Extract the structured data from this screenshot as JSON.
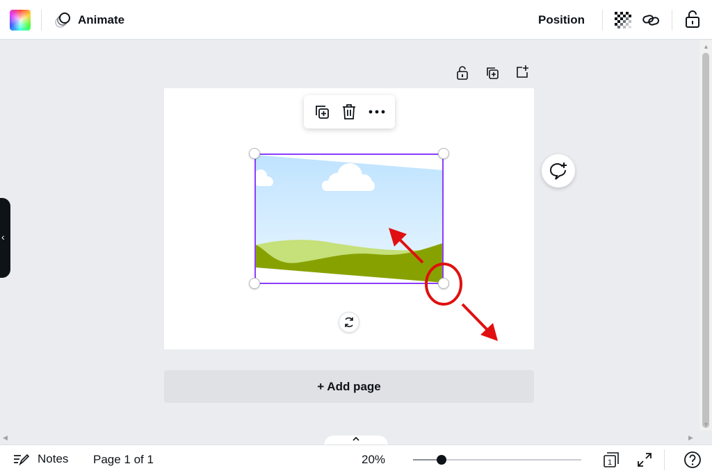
{
  "toolbar": {
    "animate_label": "Animate",
    "position_label": "Position",
    "icons": [
      "color-swatch",
      "animate-icon",
      "transparency-icon",
      "link-icon",
      "lock-icon"
    ]
  },
  "page_actions": {
    "icons": [
      "lock-icon",
      "duplicate-page-icon",
      "add-page-icon"
    ]
  },
  "context_menu": {
    "icons": [
      "duplicate-icon",
      "trash-icon",
      "more-icon"
    ]
  },
  "canvas": {
    "element": "landscape image placeholder",
    "rotate_icon": "rotate-icon",
    "comment_icon": "add-comment-icon"
  },
  "add_page_label": "+ Add page",
  "bottom": {
    "notes_label": "Notes",
    "page_indicator": "Page 1 of 1",
    "zoom_label": "20%",
    "zoom_level": 0.17,
    "page_count": "1"
  },
  "colors": {
    "selection": "#8b3dff",
    "annotation": "#e01010",
    "page_bg": "#ffffff",
    "canvas_bg": "#ebecf0"
  }
}
